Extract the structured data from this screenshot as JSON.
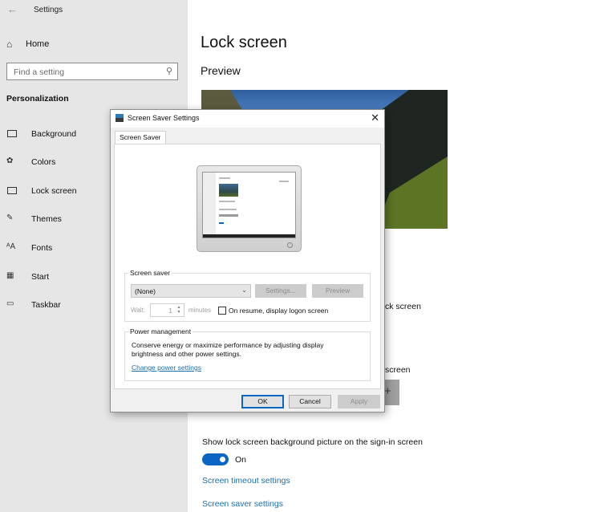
{
  "app": {
    "title": "Settings",
    "back_icon": "back-arrow-icon"
  },
  "sidebar": {
    "home_label": "Home",
    "search_placeholder": "Find a setting",
    "section_heading": "Personalization",
    "items": [
      {
        "label": "Background",
        "icon": "picture-icon"
      },
      {
        "label": "Colors",
        "icon": "palette-icon"
      },
      {
        "label": "Lock screen",
        "icon": "lock-screen-icon"
      },
      {
        "label": "Themes",
        "icon": "themes-icon"
      },
      {
        "label": "Fonts",
        "icon": "fonts-icon"
      },
      {
        "label": "Start",
        "icon": "start-icon"
      },
      {
        "label": "Taskbar",
        "icon": "taskbar-icon"
      }
    ]
  },
  "main": {
    "page_title": "Lock screen",
    "preview_heading": "Preview",
    "partial_text_1": "ck screen",
    "partial_text_2": "screen",
    "add_symbol": "+",
    "show_background_label": "Show lock screen background picture on the sign-in screen",
    "toggle_state": "On",
    "toggle_on": true,
    "links": {
      "screen_timeout": "Screen timeout settings",
      "screen_saver": "Screen saver settings"
    }
  },
  "dialog": {
    "title": "Screen Saver Settings",
    "close_symbol": "✕",
    "tab_label": "Screen Saver",
    "screen_saver": {
      "group_label": "Screen saver",
      "selected": "(None)",
      "settings_button": "Settings...",
      "preview_button": "Preview",
      "wait_label": "Wait:",
      "wait_value": "1",
      "minutes_label": "minutes",
      "on_resume_label": "On resume, display logon screen",
      "on_resume_checked": false
    },
    "power": {
      "group_label": "Power management",
      "description": "Conserve energy or maximize performance by adjusting display brightness and other power settings.",
      "link": "Change power settings"
    },
    "buttons": {
      "ok": "OK",
      "cancel": "Cancel",
      "apply": "Apply"
    }
  }
}
